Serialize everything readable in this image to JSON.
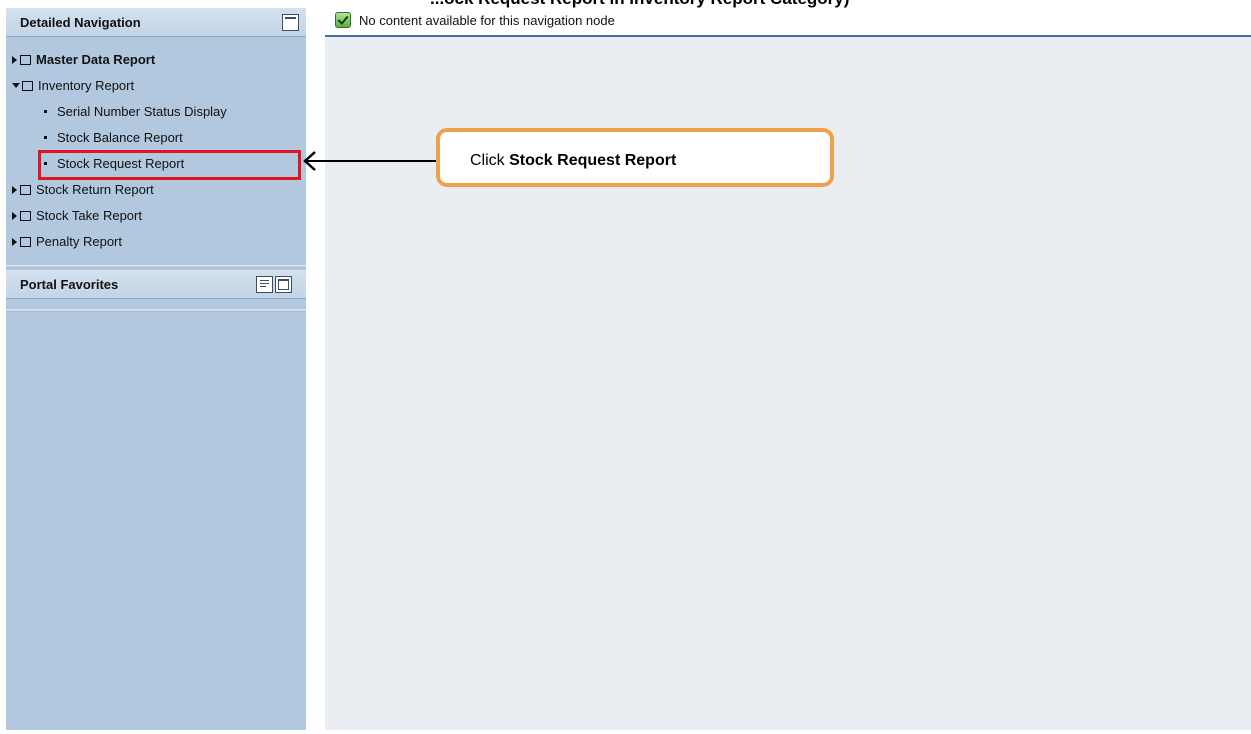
{
  "caption_fragment": "...ock Request Report in Inventory Report Category)",
  "detailed_navigation": {
    "title": "Detailed Navigation",
    "items": [
      {
        "label": "Master Data Report",
        "type": "folder",
        "expanded": false,
        "bold": true
      },
      {
        "label": "Inventory Report",
        "type": "folder",
        "expanded": true,
        "bold": false
      },
      {
        "label": "Serial Number Status Display",
        "type": "leaf"
      },
      {
        "label": "Stock Balance Report",
        "type": "leaf"
      },
      {
        "label": "Stock Request Report",
        "type": "leaf",
        "highlighted": true
      },
      {
        "label": "Stock Return Report",
        "type": "folder",
        "expanded": false
      },
      {
        "label": "Stock Take Report",
        "type": "folder",
        "expanded": false
      },
      {
        "label": "Penalty Report",
        "type": "folder",
        "expanded": false
      }
    ]
  },
  "portal_favorites": {
    "title": "Portal Favorites"
  },
  "content": {
    "status_message": "No content available for this navigation node"
  },
  "callout": {
    "prefix": "Click",
    "target": "Stock Request Report"
  },
  "colors": {
    "panel_bg": "#b2c8de",
    "content_bg": "#eaeef2",
    "highlight": "#e0141e",
    "callout_border": "#f0a04b",
    "status_underline": "#3f73a8"
  },
  "icons": [
    "minimize-icon",
    "list-icon",
    "maximize-icon",
    "check-icon",
    "folder-icon",
    "expand-arrow-icon",
    "collapse-arrow-icon",
    "bullet-icon",
    "callout-arrow-icon"
  ]
}
